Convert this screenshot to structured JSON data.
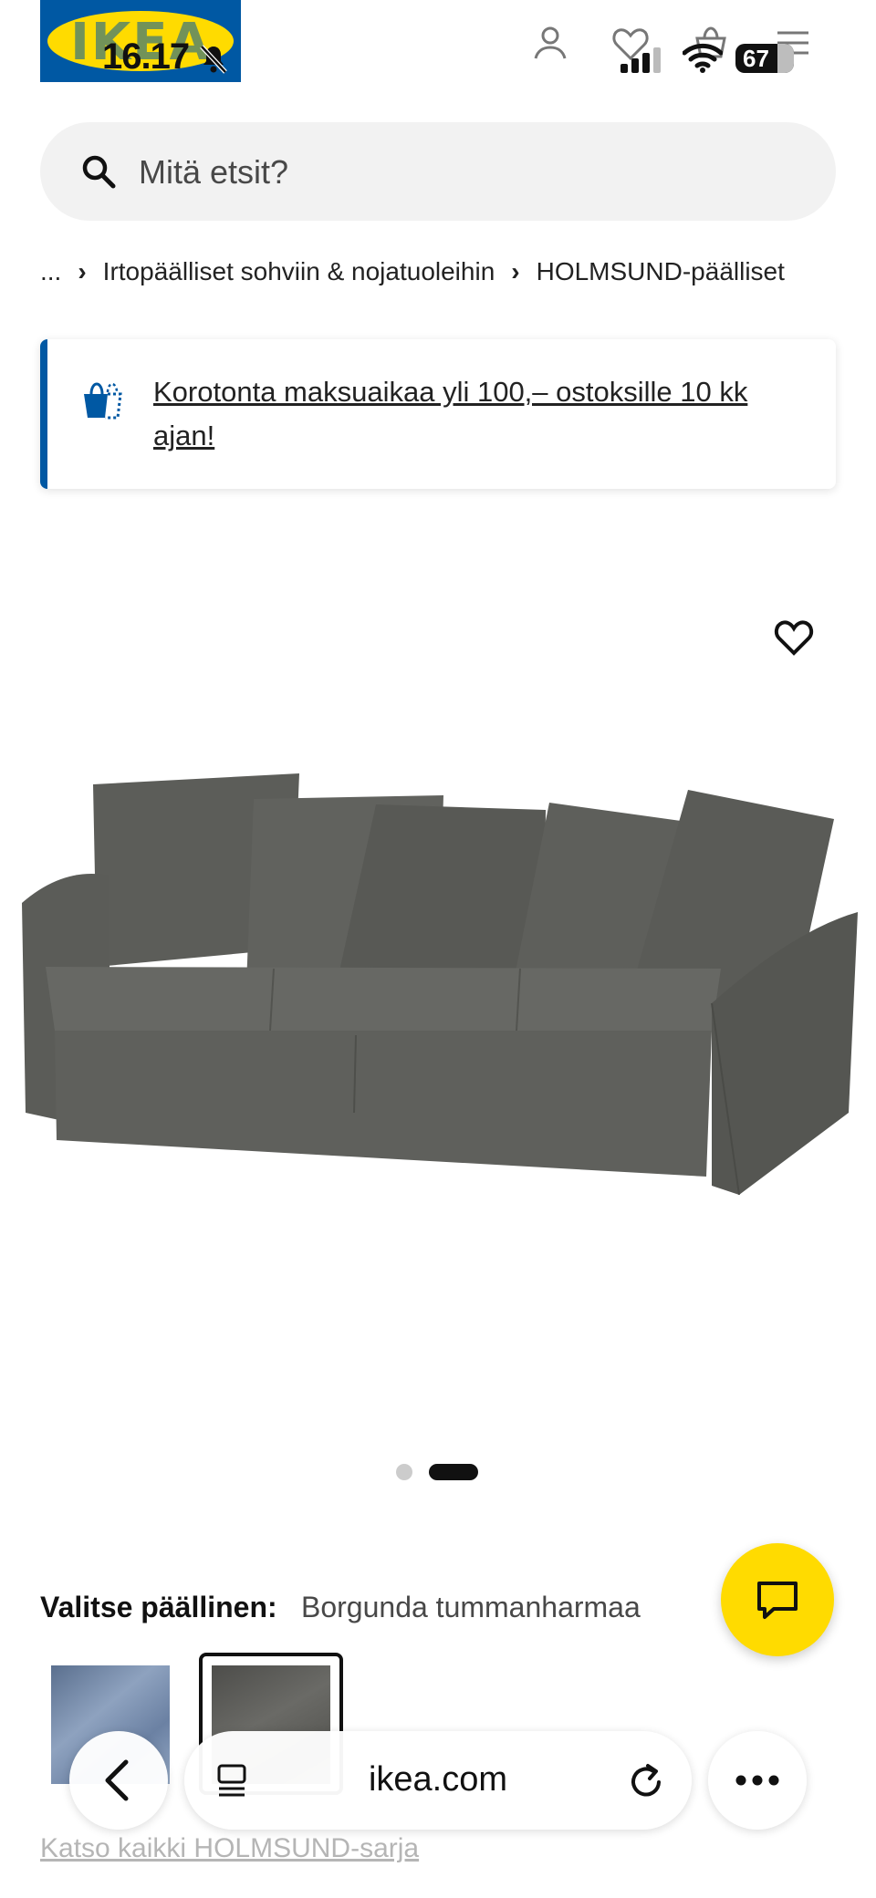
{
  "status_bar": {
    "time": "16.17",
    "battery": "67"
  },
  "brand": {
    "logo_text": "IKEA"
  },
  "search": {
    "placeholder": "Mitä etsit?"
  },
  "breadcrumb": {
    "ellipsis": "...",
    "items": [
      "Irtopäälliset sohviin & nojatuoleihin",
      "HOLMSUND-päälliset"
    ]
  },
  "banner": {
    "text": "Korotonta maksuaikaa yli 100,– ostoksille 10 kk ajan!"
  },
  "gallery": {
    "active_index": 1,
    "count": 2
  },
  "cover": {
    "label": "Valitse päällinen:",
    "selected": "Borgunda tummanharmaa"
  },
  "series_link": "Katso kaikki HOLMSUND-sarja",
  "browser": {
    "url": "ikea.com"
  },
  "colors": {
    "brand_blue": "#0058a3",
    "brand_yellow": "#ffdb00",
    "sofa": "#5f605c"
  }
}
